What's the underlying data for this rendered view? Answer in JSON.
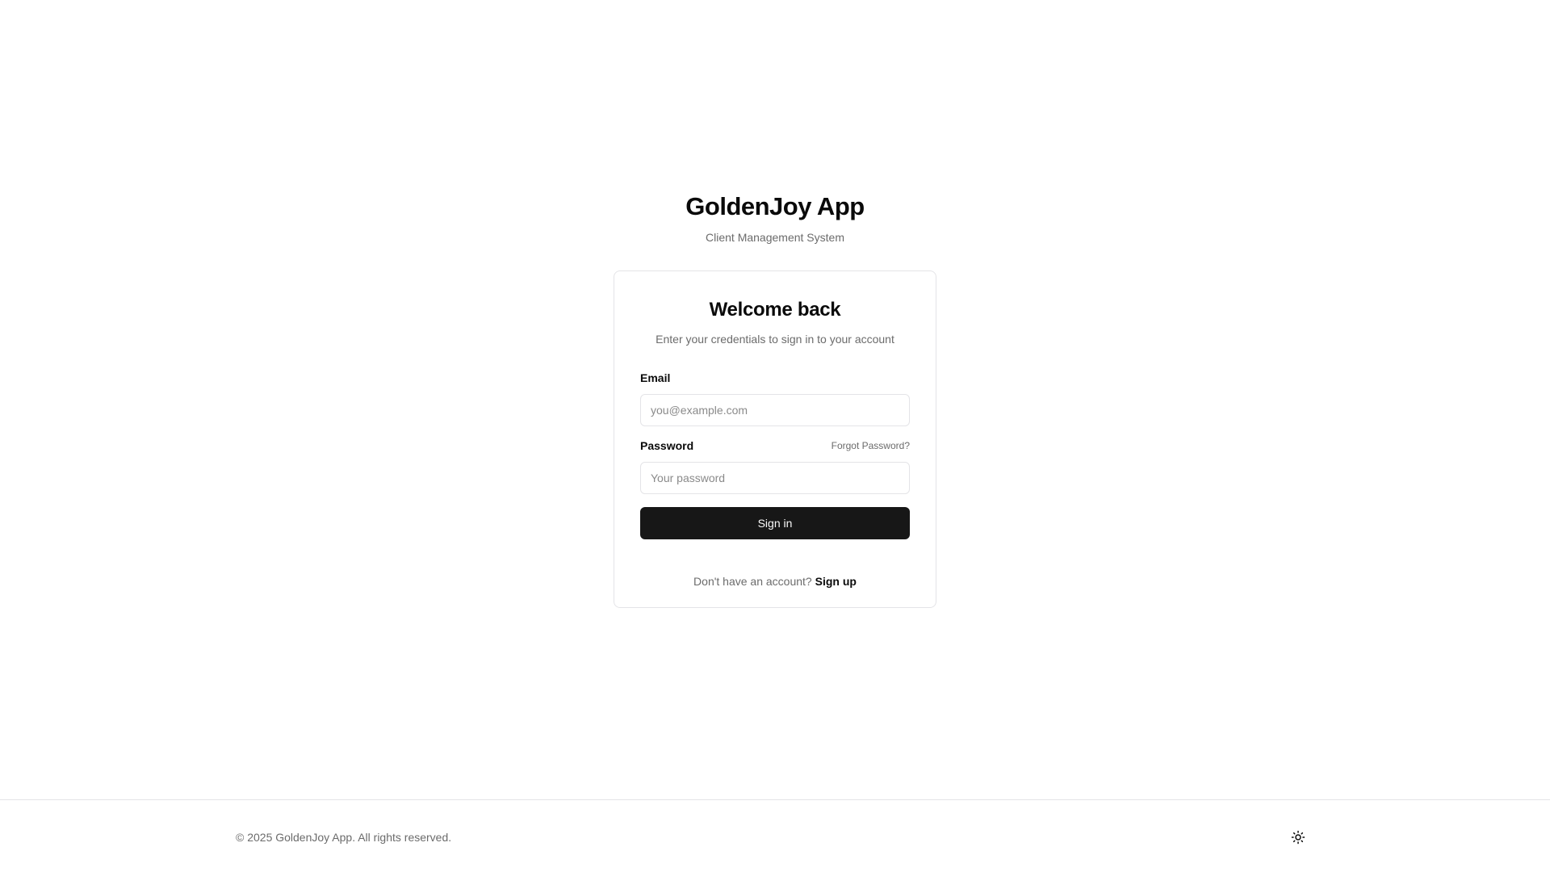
{
  "brand": {
    "title": "GoldenJoy App",
    "subtitle": "Client Management System"
  },
  "login_card": {
    "title": "Welcome back",
    "description": "Enter your credentials to sign in to your account",
    "email": {
      "label": "Email",
      "placeholder": "you@example.com",
      "value": ""
    },
    "password": {
      "label": "Password",
      "placeholder": "Your password",
      "value": "",
      "forgot_label": "Forgot Password?"
    },
    "submit_label": "Sign in",
    "signup_prompt": "Don't have an account?",
    "signup_label": "Sign up"
  },
  "footer": {
    "copyright": "© 2025 GoldenJoy App. All rights reserved.",
    "theme_toggle_icon": "sun-icon"
  },
  "colors": {
    "primary_button": "#171717",
    "muted_text": "#6b6b6b",
    "border": "#e4e4e7"
  }
}
